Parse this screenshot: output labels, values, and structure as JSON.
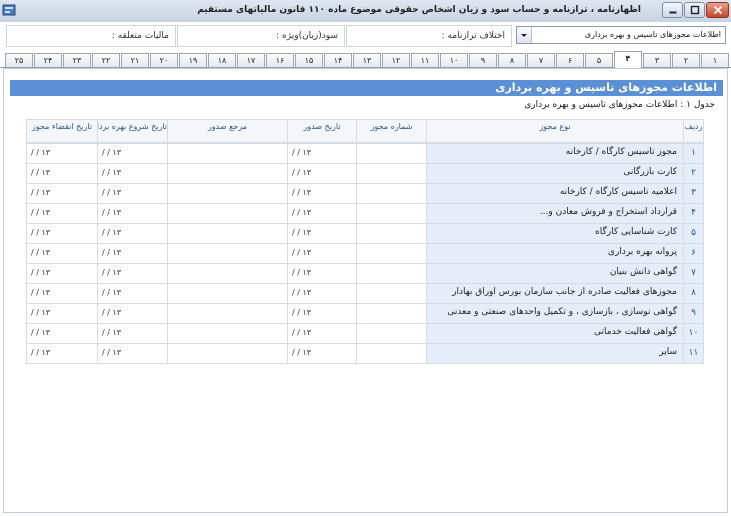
{
  "window": {
    "title": "اظهارنامه ، ترازنامه و حساب سود و زیان اشخاص حقوقی موضوع ماده ۱۱۰ قانون مالیاتهای مستقیم"
  },
  "header": {
    "combo_value": "اطلاعات مجوزهای تاسیس و بهره برداری",
    "field1_label": "اختلاف ترازنامه :",
    "field2_label": "سود(زیان)ویژه :",
    "field3_label": "مالیات متعلقه :"
  },
  "tabs": [
    "۱",
    "۲",
    "۳",
    "۴",
    "۵",
    "۶",
    "۷",
    "۸",
    "۹",
    "۱۰",
    "۱۱",
    "۱۲",
    "۱۳",
    "۱۴",
    "۱۵",
    "۱۶",
    "۱۷",
    "۱۸",
    "۱۹",
    "۲۰",
    "۲۱",
    "۲۲",
    "۲۳",
    "۲۴",
    "۲۵"
  ],
  "active_tab": 3,
  "section": {
    "title": "اطلاعات مجوزهای تاسیس و بهره برداری",
    "caption": "جدول ۱ : اطلاعات مجوزهای تاسیس و بهره برداری"
  },
  "table": {
    "columns": {
      "row": "ردیف",
      "type": "نوع مجوز",
      "number": "شماره مجوز",
      "issue_date": "تاریخ صدور",
      "authority": "مرجع صدور",
      "start_date": "تاریخ شروع بهره برداری",
      "expiry_date": "تاریخ انقضاء مجوز"
    },
    "date_placeholder": "/ /  ۱۳",
    "rows": [
      {
        "n": "۱",
        "title": "مجوز تاسیس کارگاه / کارخانه"
      },
      {
        "n": "۲",
        "title": "کارت بازرگانی"
      },
      {
        "n": "۳",
        "title": "اعلامیه تاسیس کارگاه / کارخانه"
      },
      {
        "n": "۴",
        "title": "قرارداد استخراج و فروش معادن و..."
      },
      {
        "n": "۵",
        "title": "کارت شناسایی کارگاه"
      },
      {
        "n": "۶",
        "title": "پروانه بهره برداری"
      },
      {
        "n": "۷",
        "title": "گواهی دانش بنیان"
      },
      {
        "n": "۸",
        "title": "مجوزهای فعالیت صادره از جانب سازمان بورس اوراق بهادار"
      },
      {
        "n": "۹",
        "title": "گواهی نوسازی ، بازسازی ، و تکمیل واحدهای صنعتی و معدنی"
      },
      {
        "n": "۱۰",
        "title": "گواهی فعالیت خدماتی"
      },
      {
        "n": "۱۱",
        "title": "سایر"
      }
    ]
  }
}
